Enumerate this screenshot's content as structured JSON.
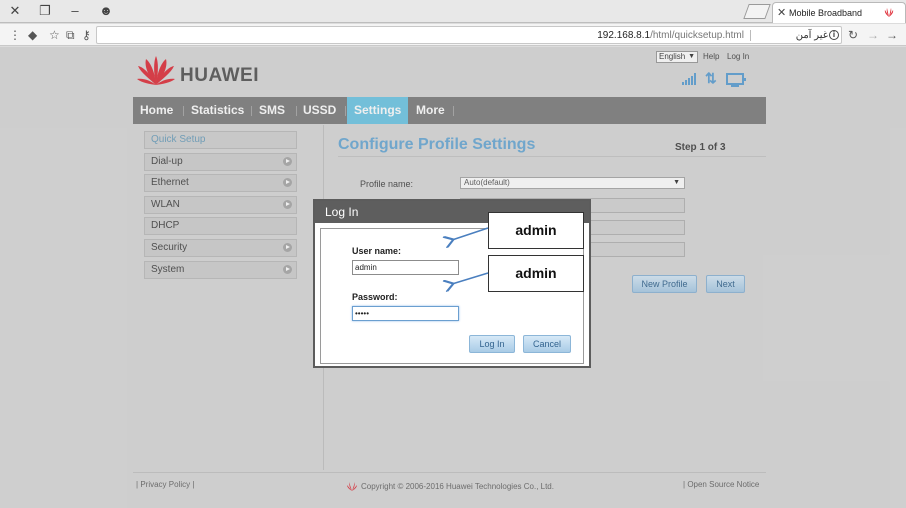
{
  "browser": {
    "tab_title": "Mobile Broadband",
    "url_host": "192.168.8.1",
    "url_path": "/html/quicksetup.html",
    "security_text": "غير آمن",
    "info_glyph": "i"
  },
  "header": {
    "language": "English",
    "help": "Help",
    "login": "Log In",
    "brand": "HUAWEI"
  },
  "nav": {
    "items": [
      "Home",
      "Statistics",
      "SMS",
      "USSD",
      "Settings",
      "More"
    ],
    "active": "Settings"
  },
  "sidebar": {
    "items": [
      {
        "label": "Quick Setup",
        "arrow": false
      },
      {
        "label": "Dial-up",
        "arrow": true
      },
      {
        "label": "Ethernet",
        "arrow": true
      },
      {
        "label": "WLAN",
        "arrow": true
      },
      {
        "label": "DHCP",
        "arrow": false
      },
      {
        "label": "Security",
        "arrow": true
      },
      {
        "label": "System",
        "arrow": true
      }
    ]
  },
  "main": {
    "title": "Configure Profile Settings",
    "step": "Step 1 of 3",
    "profile_label": "Profile name:",
    "profile_value": "Auto(default)",
    "new_profile_button": "New Profile",
    "next_button": "Next"
  },
  "footer": {
    "privacy": "Privacy Policy",
    "copyright": "Copyright © 2006-2016 Huawei Technologies Co., Ltd.",
    "open_source": "Open Source Notice"
  },
  "modal": {
    "title": "Log In",
    "username_label": "User name:",
    "username_value": "admin",
    "password_label": "Password:",
    "password_value": "•••••",
    "login_button": "Log In",
    "cancel_button": "Cancel"
  },
  "annotations": {
    "username_callout": "admin",
    "password_callout": "admin"
  },
  "colors": {
    "accent": "#6ec7e6",
    "title": "#6aaad6",
    "nav_bg": "#7d7d7d",
    "logo_red": "#e0303b"
  }
}
